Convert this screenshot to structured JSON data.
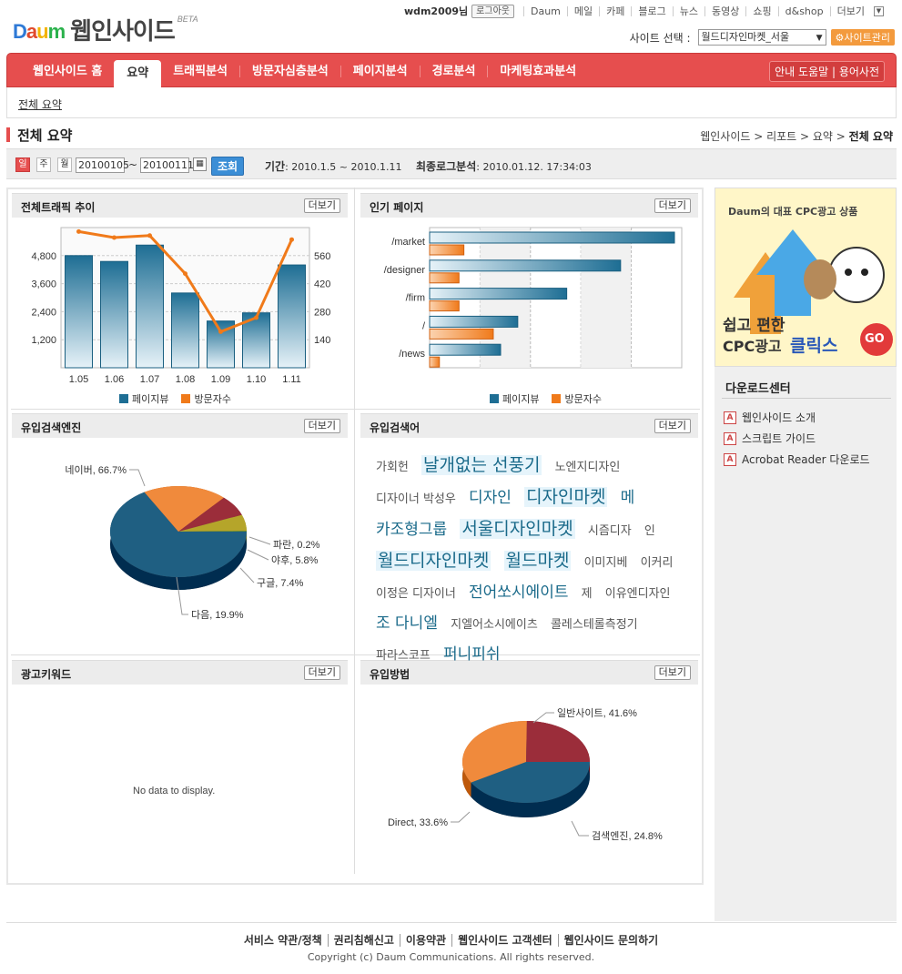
{
  "header": {
    "logo_daum": "Daum",
    "service": "웹인사이드",
    "beta": "BETA",
    "user": "wdm2009님",
    "logout": "로그아웃",
    "links": [
      "Daum",
      "메일",
      "카페",
      "블로그",
      "뉴스",
      "동영상",
      "쇼핑",
      "d&shop",
      "더보기"
    ],
    "site_select_label": "사이트 선택 :",
    "site_selected": "월드디자인마켓_서울",
    "site_manage": "사이트관리"
  },
  "nav": {
    "tabs": [
      "웹인사이드 홈",
      "요약",
      "트래픽분석",
      "방문자심층분석",
      "페이지분석",
      "경로분석",
      "마케팅효과분석"
    ],
    "active": "요약",
    "help": "안내 도움말 | 용어사전"
  },
  "subnav": {
    "item": "전체 요약"
  },
  "page": {
    "title": "전체 요약",
    "breadcrumb": "웹인사이드 > 리포트 > 요약 > ",
    "breadcrumb_current": "전체 요약"
  },
  "datebar": {
    "day": "일",
    "week": "주",
    "month": "월",
    "start": "20100105",
    "tilde": "~",
    "end": "20100111",
    "query": "조회",
    "period_label": "기간",
    "period": ": 2010.1.5 ~ 2010.1.11",
    "last_label": "최종로그분석",
    "last": ": 2010.01.12. 17:34:03"
  },
  "panels": {
    "traffic": "전체트래픽 추이",
    "popular": "인기 페이지",
    "engine": "유입검색엔진",
    "keyword": "유입검색어",
    "ad": "광고키워드",
    "method": "유입방법",
    "more": "더보기"
  },
  "legend": {
    "pv": "페이지뷰",
    "uv": "방문자수",
    "pv_color": "#1e6e94",
    "uv_color": "#f07a1a"
  },
  "chart_data": [
    {
      "type": "bar",
      "title": "전체트래픽 추이",
      "categories": [
        "1.05",
        "1.06",
        "1.07",
        "1.08",
        "1.09",
        "1.10",
        "1.11"
      ],
      "series": [
        {
          "name": "페이지뷰",
          "values": [
            4800,
            4550,
            5250,
            3200,
            2000,
            2350,
            4400
          ]
        },
        {
          "name": "방문자수",
          "values": [
            680,
            650,
            660,
            470,
            180,
            250,
            640
          ]
        }
      ],
      "yticks_left": [
        "1,200",
        "2,400",
        "3,600",
        "4,800"
      ],
      "yticks_right": [
        "140",
        "280",
        "420",
        "560"
      ],
      "ylim_left": [
        0,
        6000
      ],
      "ylim_right": [
        0,
        700
      ]
    },
    {
      "type": "bar",
      "title": "인기 페이지",
      "orientation": "horizontal",
      "categories": [
        "/market",
        "/designer",
        "/firm",
        "/",
        "/news"
      ],
      "series": [
        {
          "name": "페이지뷰",
          "values": [
            100,
            78,
            56,
            36,
            29
          ]
        },
        {
          "name": "방문자수",
          "values": [
            14,
            12,
            12,
            26,
            4
          ]
        }
      ]
    },
    {
      "type": "pie",
      "title": "유입검색엔진",
      "labels": [
        "네이버, 66.7%",
        "다음, 19.9%",
        "구글, 7.4%",
        "야후, 5.8%",
        "파란, 0.2%"
      ],
      "values": [
        66.7,
        19.9,
        7.4,
        5.8,
        0.2
      ],
      "colors": [
        "#1f5f82",
        "#f08a3c",
        "#9b2d3a",
        "#b5a52a",
        "#3a7d3a"
      ]
    },
    {
      "type": "pie",
      "title": "유입방법",
      "labels": [
        "일반사이트, 41.6%",
        "Direct, 33.6%",
        "검색엔진, 24.8%"
      ],
      "values": [
        41.6,
        33.6,
        24.8
      ],
      "colors": [
        "#1f5f82",
        "#f08a3c",
        "#9b2d3a"
      ]
    }
  ],
  "keywords": [
    {
      "t": "가회헌",
      "s": "n"
    },
    {
      "t": "날개없는 선풍기",
      "s": "h"
    },
    {
      "t": "노엔지디자인",
      "s": "n"
    },
    {
      "t": "디자이너 박성우",
      "s": "n"
    },
    {
      "t": "디자인",
      "s": "b"
    },
    {
      "t": "디자인마켓",
      "s": "h"
    },
    {
      "t": "메",
      "s": "b"
    },
    {
      "t": "카조형그룹",
      "s": "b"
    },
    {
      "t": "서울디자인마켓",
      "s": "h"
    },
    {
      "t": "시즘디자",
      "s": "n"
    },
    {
      "t": "인",
      "s": "n"
    },
    {
      "t": "월드디자인마켓",
      "s": "h"
    },
    {
      "t": "월드마켓",
      "s": "h"
    },
    {
      "t": "이미지베",
      "s": "n"
    },
    {
      "t": "이커리",
      "s": "n"
    },
    {
      "t": "이정은 디자이너",
      "s": "n"
    },
    {
      "t": "전어쏘시에이트",
      "s": "b"
    },
    {
      "t": "제",
      "s": "n"
    },
    {
      "t": "이유엔디자인",
      "s": "n"
    },
    {
      "t": "조 다니엘",
      "s": "b"
    },
    {
      "t": "지엘어소시에이츠",
      "s": "n"
    },
    {
      "t": "콜레스테롤측정기",
      "s": "n"
    },
    {
      "t": "파라스코프",
      "s": "n"
    },
    {
      "t": "퍼니피쉬",
      "s": "b"
    }
  ],
  "adkeyword": {
    "nodata": "No data to display."
  },
  "side": {
    "ad_text1": "Daum의 대표 CPC광고 상품",
    "ad_text2": "쉽고 편한",
    "ad_text3": "CPC광고",
    "ad_text4": "클릭스",
    "ad_go": "GO",
    "download_title": "다운로드센터",
    "downloads": [
      "웹인사이드 소개",
      "스크립트 가이드",
      "Acrobat Reader 다운로드"
    ]
  },
  "footer": {
    "links": [
      "서비스 약관/정책",
      "권리침해신고",
      "이용약관",
      "웹인사이드 고객센터",
      "웹인사이드 문의하기"
    ],
    "copyright": "Copyright (c) Daum Communications. All rights reserved."
  }
}
